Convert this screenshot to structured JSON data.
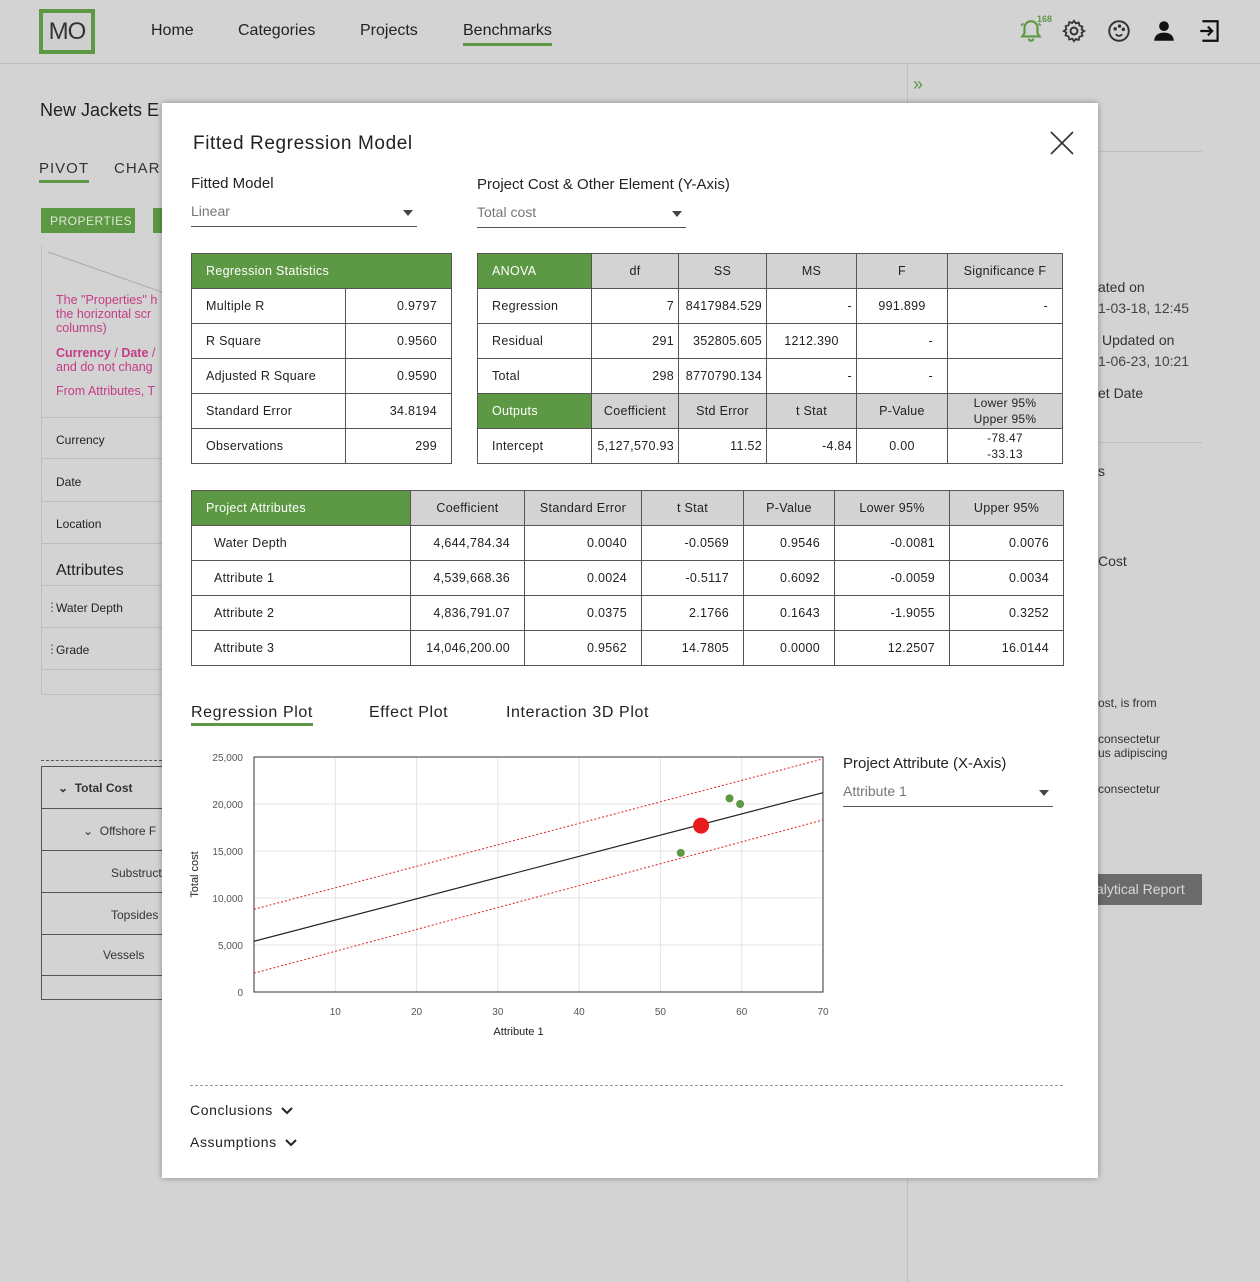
{
  "app": {
    "logo": "MO",
    "nav": [
      "Home",
      "Categories",
      "Projects",
      "Benchmarks"
    ],
    "notification_count": "168"
  },
  "background": {
    "page_title": "New Jackets E",
    "tabs": [
      "PIVOT",
      "CHAR"
    ],
    "properties_btn": "PROPERTIES",
    "pink_note_1": "The \"Properties\" h",
    "pink_note_2": "the horizontal scr",
    "pink_note_3": "columns)",
    "pink_note_4a": "Currency",
    "pink_note_4b": " / ",
    "pink_note_4c": "Date",
    "pink_note_4d": " /",
    "pink_note_5": "and do not chang",
    "pink_note_6": "From Attributes, T",
    "rows": [
      "Currency",
      "Date",
      "Location"
    ],
    "attributes_heading": "Attributes",
    "attr_rows": [
      "Water Depth",
      "Grade"
    ],
    "tree": [
      "Total Cost",
      "Offshore F",
      "Substruct",
      "Topsides",
      "Vessels"
    ],
    "right_panel": [
      "ated on",
      "1-03-18, 12:45",
      "Updated on",
      "1-06-23, 10:21",
      "et Date",
      "s",
      "Cost",
      "ost, is from",
      "consectetur",
      "us adipiscing",
      "consectetur"
    ],
    "report_btn": "alytical Report"
  },
  "modal": {
    "title": "Fitted Regression Model",
    "fitted_model_label": "Fitted Model",
    "fitted_model_value": "Linear",
    "y_axis_label": "Project Cost & Other Element (Y-Axis)",
    "y_axis_value": "Total cost",
    "regression_stats": {
      "header": "Regression Statistics",
      "rows": [
        [
          "Multiple R",
          "0.9797"
        ],
        [
          "R Square",
          "0.9560"
        ],
        [
          "Adjusted R Square",
          "0.9590"
        ],
        [
          "Standard Error",
          "34.8194"
        ],
        [
          "Observations",
          "299"
        ]
      ]
    },
    "anova": {
      "headers": [
        "ANOVA",
        "df",
        "SS",
        "MS",
        "F",
        "Significance F"
      ],
      "rows": [
        [
          "Regression",
          "7",
          "8417984.529",
          "-",
          "991.899",
          "-"
        ],
        [
          "Residual",
          "291",
          "352805.605",
          "1212.390",
          "-",
          ""
        ],
        [
          "Total",
          "298",
          "8770790.134",
          "-",
          "-",
          ""
        ]
      ],
      "out_headers": [
        "Outputs",
        "Coefficient",
        "Std Error",
        "t Stat",
        "P-Value",
        "Lower 95%",
        "Upper 95%"
      ],
      "out_row": [
        "Intercept",
        "5,127,570.93",
        "11.52",
        "-4.84",
        "0.00",
        "-78.47",
        "-33.13"
      ]
    },
    "attributes": {
      "headers": [
        "Project Attributes",
        "Coefficient",
        "Standard Error",
        "t Stat",
        "P-Value",
        "Lower 95%",
        "Upper 95%"
      ],
      "rows": [
        [
          "Water Depth",
          "4,644,784.34",
          "0.0040",
          "-0.0569",
          "0.9546",
          "-0.0081",
          "0.0076"
        ],
        [
          "Attribute 1",
          "4,539,668.36",
          "0.0024",
          "-0.5117",
          "0.6092",
          "-0.0059",
          "0.0034"
        ],
        [
          "Attribute 2",
          "4,836,791.07",
          "0.0375",
          "2.1766",
          "0.1643",
          "-1.9055",
          "0.3252"
        ],
        [
          "Attribute 3",
          "14,046,200.00",
          "0.9562",
          "14.7805",
          "0.0000",
          "12.2507",
          "16.0144"
        ]
      ]
    },
    "plot_tabs": [
      "Regression Plot",
      "Effect Plot",
      "Interaction 3D Plot"
    ],
    "x_axis_label": "Project Attribute (X-Axis)",
    "x_axis_value": "Attribute 1",
    "accordions": [
      "Conclusions",
      "Assumptions"
    ]
  },
  "chart_data": {
    "type": "scatter",
    "xlabel": "Attribute 1",
    "ylabel": "Total cost",
    "xlim": [
      0,
      70
    ],
    "ylim": [
      0,
      25000
    ],
    "x_ticks": [
      10,
      20,
      30,
      40,
      50,
      60,
      70
    ],
    "y_ticks": [
      0,
      5000,
      10000,
      15000,
      20000,
      25000
    ],
    "y_tick_labels": [
      "0",
      "5,000",
      "10,000",
      "15,000",
      "20,000",
      "25,000"
    ],
    "grid": true,
    "points": [
      {
        "x": 52.5,
        "y": 14800
      },
      {
        "x": 58.5,
        "y": 20600
      },
      {
        "x": 59.8,
        "y": 20000
      }
    ],
    "highlight_point": {
      "x": 55,
      "y": 17700
    },
    "fit_line": [
      {
        "x": 0,
        "y": 5400
      },
      {
        "x": 70,
        "y": 21200
      }
    ],
    "upper_band": [
      {
        "x": 0,
        "y": 8800
      },
      {
        "x": 70,
        "y": 24800
      }
    ],
    "lower_band": [
      {
        "x": 0,
        "y": 2000
      },
      {
        "x": 70,
        "y": 18300
      }
    ],
    "colors": {
      "point": "#5d9845",
      "highlight": "#e81c1c",
      "fit": "#222222",
      "band": "#e02020"
    }
  }
}
